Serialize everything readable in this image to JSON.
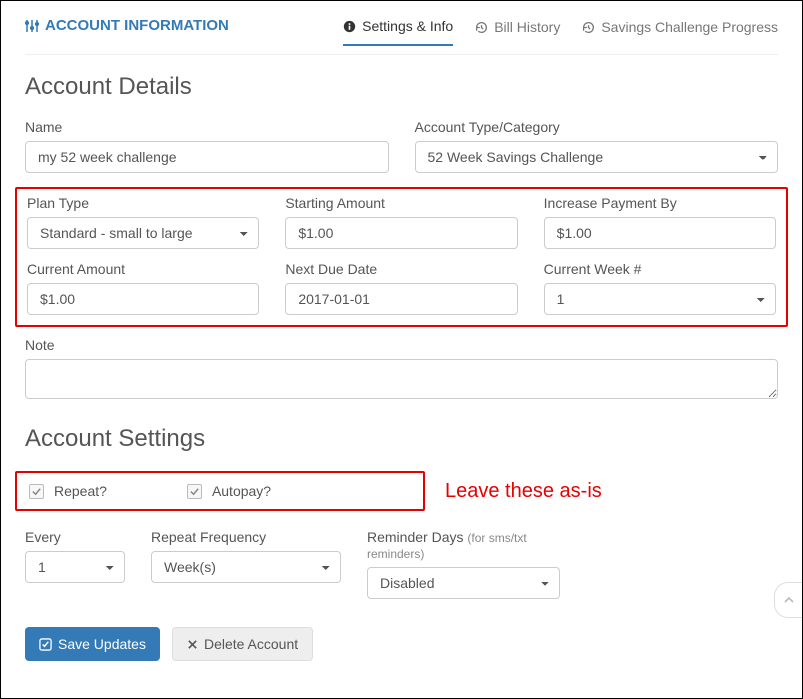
{
  "header": {
    "title": "ACCOUNT INFORMATION",
    "tabs": {
      "settings": "Settings & Info",
      "history": "Bill History",
      "progress": "Savings Challenge Progress"
    }
  },
  "details": {
    "section_title": "Account Details",
    "name_label": "Name",
    "name_value": "my 52 week challenge",
    "type_label": "Account Type/Category",
    "type_value": "52 Week Savings Challenge",
    "plan_type_label": "Plan Type",
    "plan_type_value": "Standard - small to large",
    "starting_amount_label": "Starting Amount",
    "starting_amount_value": "$1.00",
    "increase_by_label": "Increase Payment By",
    "increase_by_value": "$1.00",
    "current_amount_label": "Current Amount",
    "current_amount_value": "$1.00",
    "next_due_label": "Next Due Date",
    "next_due_value": "2017-01-01",
    "current_week_label": "Current Week #",
    "current_week_value": "1",
    "note_label": "Note",
    "note_value": ""
  },
  "settings": {
    "section_title": "Account Settings",
    "repeat_label": "Repeat?",
    "autopay_label": "Autopay?",
    "annotation": "Leave these as-is",
    "every_label": "Every",
    "every_value": "1",
    "freq_label": "Repeat Frequency",
    "freq_value": "Week(s)",
    "reminder_label": "Reminder Days",
    "reminder_sub": "(for sms/txt reminders)",
    "reminder_value": "Disabled"
  },
  "buttons": {
    "save": "Save Updates",
    "delete": "Delete Account"
  }
}
